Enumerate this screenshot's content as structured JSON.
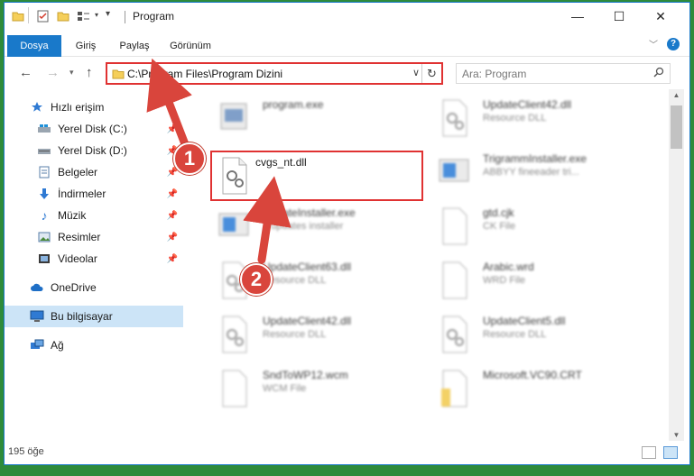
{
  "window": {
    "title": "Program",
    "controls": {
      "minimize": "—",
      "maximize": "☐",
      "close": "✕"
    }
  },
  "ribbon": {
    "tabs": [
      "Dosya",
      "Giriş",
      "Paylaş",
      "Görünüm"
    ]
  },
  "address": {
    "path": "C:\\Program Files\\Program Dizini"
  },
  "search": {
    "placeholder": "Ara: Program"
  },
  "sidebar": {
    "items": [
      {
        "label": "Hızlı erişim",
        "icon": "star-icon"
      },
      {
        "label": "Yerel Disk (C:)",
        "icon": "drive-icon"
      },
      {
        "label": "Yerel Disk (D:)",
        "icon": "drive-icon"
      },
      {
        "label": "Belgeler",
        "icon": "documents-icon"
      },
      {
        "label": "İndirmeler",
        "icon": "download-icon"
      },
      {
        "label": "Müzik",
        "icon": "music-icon"
      },
      {
        "label": "Resimler",
        "icon": "pictures-icon"
      },
      {
        "label": "Videolar",
        "icon": "videos-icon"
      },
      {
        "label": "OneDrive",
        "icon": "cloud-icon"
      },
      {
        "label": "Bu bilgisayar",
        "icon": "computer-icon"
      },
      {
        "label": "Ağ",
        "icon": "network-icon"
      }
    ]
  },
  "files": [
    {
      "name": "program.exe",
      "sub": ""
    },
    {
      "name": "UpdateClient42.dll",
      "sub": "Resource DLL"
    },
    {
      "name": "cvgs_nt.dll",
      "sub": ""
    },
    {
      "name": "TrigrammInstaller.exe",
      "sub": "ABBYY fineeader tri..."
    },
    {
      "name": "UpdateInstaller.exe",
      "sub": "1 updates installer"
    },
    {
      "name": "gtd.cjk",
      "sub": "CK File"
    },
    {
      "name": "UpdateClient63.dll",
      "sub": "Resource DLL"
    },
    {
      "name": "Arabic.wrd",
      "sub": "WRD File"
    },
    {
      "name": "UpdateClient42.dll",
      "sub": "Resource DLL"
    },
    {
      "name": "UpdateClient5.dll",
      "sub": "Resource DLL"
    },
    {
      "name": "SndToWP12.wcm",
      "sub": "WCM File"
    },
    {
      "name": "Microsoft.VC90.CRT",
      "sub": ""
    }
  ],
  "status": {
    "count": "195 öğe"
  },
  "annotations": {
    "badge1": "1",
    "badge2": "2",
    "color": "#d9453c"
  }
}
